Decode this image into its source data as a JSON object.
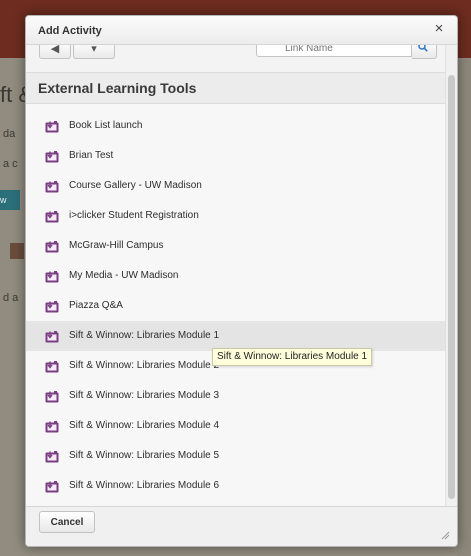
{
  "background": {
    "title_fragment": "ft &",
    "text_fragments": [
      "da",
      "a c",
      "d a"
    ],
    "button_fragment": "w"
  },
  "dialog": {
    "title": "Add Activity",
    "close_label": "×"
  },
  "toolbar": {
    "search_placeholder": "Link Name"
  },
  "section": {
    "heading": "External Learning Tools"
  },
  "items": [
    {
      "label": "Book List launch",
      "icon": "external-tool-icon"
    },
    {
      "label": "Brian Test",
      "icon": "external-tool-icon"
    },
    {
      "label": "Course Gallery - UW Madison",
      "icon": "external-tool-icon"
    },
    {
      "label": "i>clicker Student Registration",
      "icon": "external-tool-icon"
    },
    {
      "label": "McGraw-Hill Campus",
      "icon": "external-tool-icon"
    },
    {
      "label": "My Media - UW Madison",
      "icon": "external-tool-icon"
    },
    {
      "label": "Piazza Q&A",
      "icon": "external-tool-icon"
    },
    {
      "label": "Sift & Winnow: Libraries Module 1",
      "icon": "external-tool-icon",
      "hovered": true
    },
    {
      "label": "Sift & Winnow: Libraries Module 2",
      "icon": "external-tool-icon"
    },
    {
      "label": "Sift & Winnow: Libraries Module 3",
      "icon": "external-tool-icon"
    },
    {
      "label": "Sift & Winnow: Libraries Module 4",
      "icon": "external-tool-icon"
    },
    {
      "label": "Sift & Winnow: Libraries Module 5",
      "icon": "external-tool-icon"
    },
    {
      "label": "Sift & Winnow: Libraries Module 6",
      "icon": "external-tool-icon"
    }
  ],
  "tooltip": {
    "text": "Sift & Winnow: Libraries Module 1"
  },
  "footer": {
    "cancel_label": "Cancel"
  },
  "colors": {
    "icon_purple": "#7a3f82",
    "hover_row": "#e4e4e4",
    "tooltip_bg": "#ffffdc",
    "page_header": "#6d2c1f"
  }
}
